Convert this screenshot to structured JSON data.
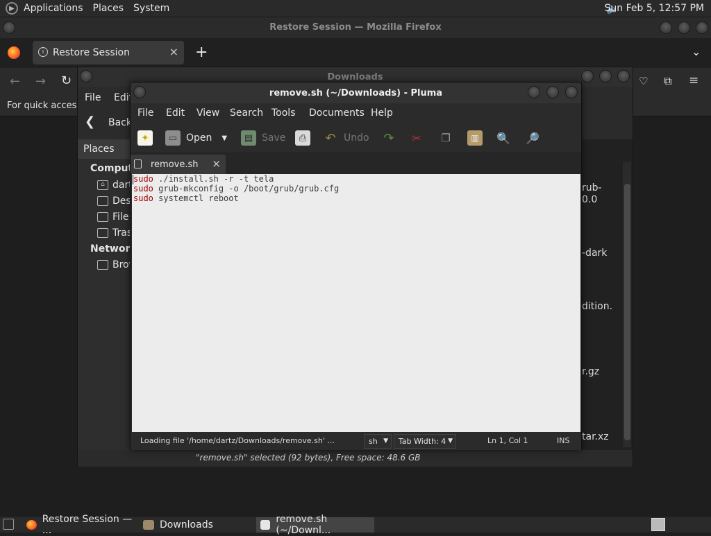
{
  "top_panel": {
    "menus": [
      "Applications",
      "Places",
      "System"
    ],
    "clock": "Sun Feb  5, 12:57 PM"
  },
  "firefox": {
    "title": "Restore Session — Mozilla Firefox",
    "tab_label": "Restore Session",
    "quick_access_text": "For quick access,"
  },
  "caja": {
    "title": "Downloads",
    "menus": [
      "File",
      "Edit"
    ],
    "back_label": "Back",
    "places_label": "Places",
    "sidebar": {
      "computer_header": "Compute",
      "items": [
        "dart",
        "Des",
        "File",
        "Tras"
      ],
      "network_header": "Network",
      "network_items": [
        "Brov"
      ]
    },
    "peek_texts": [
      "rub-",
      "0.0",
      "-dark",
      "dition.",
      "r.gz",
      "tar.xz"
    ],
    "status": "\"remove.sh\" selected (92 bytes), Free space: 48.6 GB"
  },
  "pluma": {
    "title": "remove.sh (~/Downloads) - Pluma",
    "menus": [
      "File",
      "Edit",
      "View",
      "Search",
      "Tools",
      "Documents",
      "Help"
    ],
    "toolbar": {
      "open_label": "Open",
      "save_label": "Save",
      "undo_label": "Undo"
    },
    "tab_label": "remove.sh",
    "lines": [
      {
        "kw": "sudo",
        "rest": " ./install.sh -r -t tela"
      },
      {
        "kw": "sudo",
        "rest": " grub-mkconfig -o /boot/grub/grub.cfg"
      },
      {
        "kw": "sudo",
        "rest": " systemctl reboot"
      }
    ],
    "status": {
      "loading": "Loading file '/home/dartz/Downloads/remove.sh' ...",
      "language": "sh",
      "tab_width": "Tab Width:  4",
      "position": "Ln 1, Col 1",
      "mode": "INS"
    }
  },
  "taskbar": {
    "items": [
      "Restore Session — ...",
      "Downloads",
      "remove.sh (~/Downl..."
    ]
  }
}
